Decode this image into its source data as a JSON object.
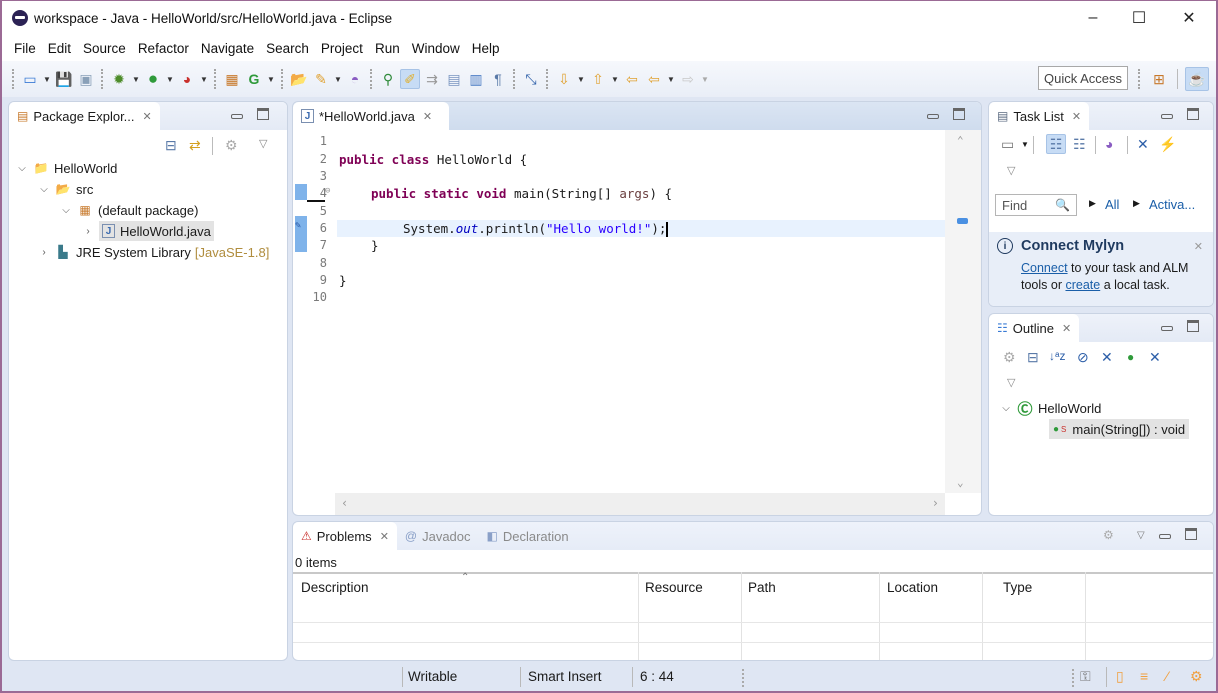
{
  "window": {
    "title": "workspace - Java - HelloWorld/src/HelloWorld.java - Eclipse",
    "controls": {
      "minimize": "–",
      "maximize": "☐",
      "close": "✕"
    }
  },
  "menu": [
    "File",
    "Edit",
    "Source",
    "Refactor",
    "Navigate",
    "Search",
    "Project",
    "Run",
    "Window",
    "Help"
  ],
  "toolbar": {
    "quick_access": "Quick Access",
    "icons": [
      "new-icon",
      "save-icon",
      "save-all-icon",
      "debug-icon",
      "run-icon",
      "run-coverage-icon",
      "new-java-package-icon",
      "new-java-class-icon",
      "open-type-icon",
      "search-icon",
      "open-task-icon",
      "toggle-annotation-icon",
      "toggle-mark-occurrences-icon",
      "toggle-word-wrap-icon",
      "toggle-block-selection-icon",
      "show-whitespace-icon",
      "next-annotation-icon",
      "previous-annotation-icon",
      "last-edit-icon",
      "back-icon",
      "forward-icon",
      "open-perspective-icon",
      "java-perspective-icon"
    ]
  },
  "package_explorer": {
    "tab_label": "Package Explor...",
    "tree": [
      {
        "label": "HelloWorld",
        "expanded": true,
        "icon": "project-icon"
      },
      {
        "label": "src",
        "expanded": true,
        "icon": "source-folder-icon"
      },
      {
        "label": "(default package)",
        "expanded": true,
        "icon": "package-icon"
      },
      {
        "label": "HelloWorld.java",
        "expanded": false,
        "icon": "java-file-icon",
        "selected": true
      },
      {
        "label": "JRE System Library",
        "decoration": "[JavaSE-1.8]",
        "expanded": false,
        "icon": "library-icon"
      }
    ]
  },
  "editor": {
    "tab_label": "*HelloWorld.java",
    "line_numbers": [
      "1",
      "2",
      "3",
      "4",
      "5",
      "6",
      "7",
      "8",
      "9",
      "10"
    ],
    "code": {
      "l2_kw": "public class",
      "l2_rest": " HelloWorld {",
      "l4_kw": "public static void",
      "l4_mid": " main(String[] ",
      "l4_param": "args",
      "l4_end": ") {",
      "l6_a": "System.",
      "l6_field": "out",
      "l6_b": ".println(",
      "l6_str": "\"Hello world!\"",
      "l6_c": ");",
      "l7": "}",
      "l9": "}"
    }
  },
  "task_list": {
    "tab_label": "Task List",
    "find_placeholder": "Find",
    "filter_all": "All",
    "filter_activate": "Activa...",
    "mylyn": {
      "title": "Connect Mylyn",
      "connect_link": "Connect",
      "text1": " to your task and ALM tools or ",
      "create_link": "create",
      "text2": " a local task."
    }
  },
  "outline": {
    "tab_label": "Outline",
    "class_name": "HelloWorld",
    "method": "main(String[]) : void",
    "method_modifier": "S"
  },
  "problems": {
    "tabs": [
      "Problems",
      "Javadoc",
      "Declaration"
    ],
    "items_count": "0 items",
    "columns": [
      "Description",
      "Resource",
      "Path",
      "Location",
      "Type"
    ]
  },
  "status": {
    "writable": "Writable",
    "insert_mode": "Smart Insert",
    "position": "6 : 44"
  }
}
